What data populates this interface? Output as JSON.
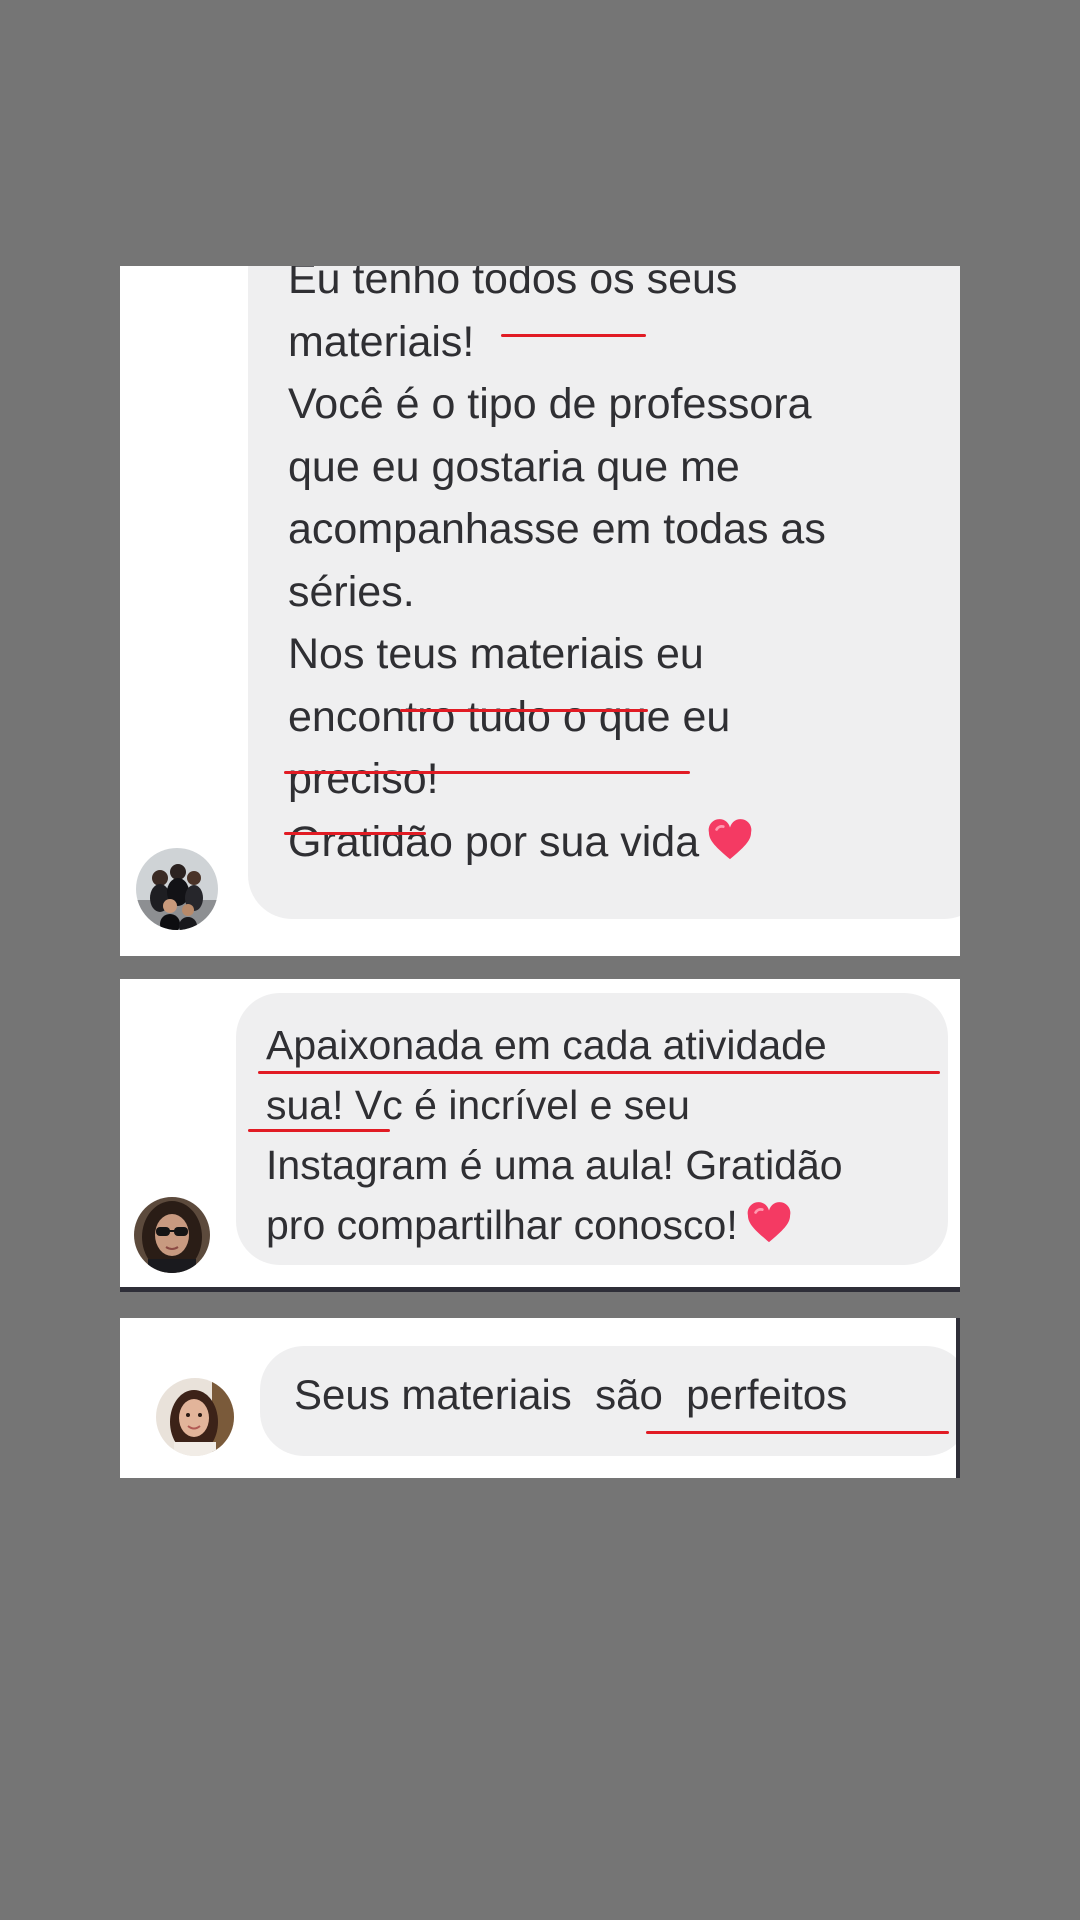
{
  "messages": [
    {
      "lines": [
        "Eu tenho todos os seus",
        "materiais!",
        "Você é o tipo de professora",
        "que eu gostaria que me",
        "acompanhasse em todas as",
        "séries.",
        "Nos teus materiais eu",
        "encontro tudo o que eu",
        "preciso!",
        "Gratidão por sua vida"
      ],
      "emoji": "heart-emoji"
    },
    {
      "lines": [
        "Apaixonada em cada atividade",
        "sua! Vc é incrível e seu",
        "Instagram é uma aula! Gratidão",
        "pro compartilhar conosco!"
      ],
      "emoji": "heart-emoji"
    },
    {
      "lines": [
        "Seus materiais  são  perfeitos"
      ]
    }
  ],
  "colors": {
    "background": "#757575",
    "card": "#ffffff",
    "bubble": "#efeff0",
    "text": "#2f2f33",
    "underline": "#e11b24",
    "heart": "#f43a63"
  }
}
